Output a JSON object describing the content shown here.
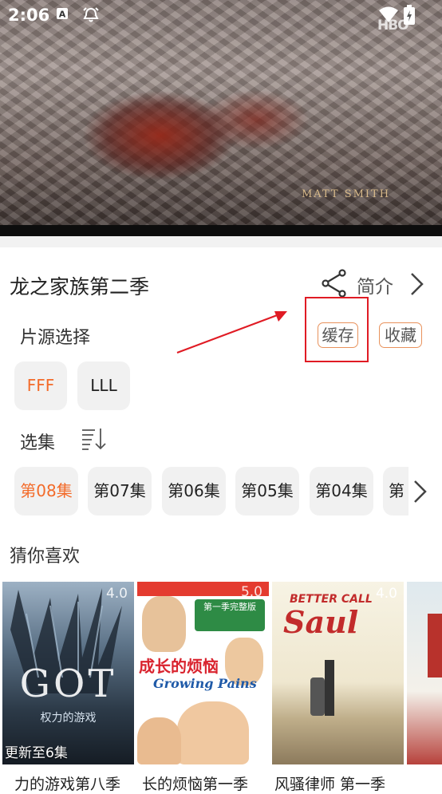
{
  "status_bar": {
    "time": "2:06",
    "icons": [
      "a-badge-icon",
      "alarm-bell-icon",
      "wifi-icon",
      "battery-charging-icon"
    ]
  },
  "video": {
    "caption": "Matt Smith",
    "channel_logo": "HBO"
  },
  "detail": {
    "title": "龙之家族第二季",
    "share_icon": "share-icon",
    "intro_label": "简介"
  },
  "source": {
    "label": "片源选择",
    "cache_label": "缓存",
    "favorite_label": "收藏",
    "options": [
      "FFF",
      "LLL"
    ],
    "selected": "FFF"
  },
  "episodes": {
    "label": "选集",
    "items": [
      "第08集",
      "第07集",
      "第06集",
      "第05集",
      "第04集",
      "第"
    ],
    "selected": "第08集"
  },
  "recommend": {
    "title": "猜你喜欢",
    "items": [
      {
        "name": "力的游戏第八季",
        "rating": "4.0",
        "note": "更新至6集",
        "poster_text": "GOT",
        "poster_sub": "权力的游戏"
      },
      {
        "name": "长的烦恼第一季",
        "rating": "5.0",
        "poster_text": "成长的烦恼",
        "poster_sub": "Growing Pains",
        "poster_top": "第一季完整版"
      },
      {
        "name": "风骚律师 第一季",
        "rating": "4.0",
        "poster_text": "Saul",
        "poster_sub": "BETTER CALL"
      },
      {
        "name": "",
        "rating": "",
        "poster_text": ""
      }
    ]
  },
  "colors": {
    "accent": "#f36b2a",
    "outline": "#e8925c",
    "highlight_red": "#e01b24",
    "chip_bg": "#f1f1f1"
  }
}
